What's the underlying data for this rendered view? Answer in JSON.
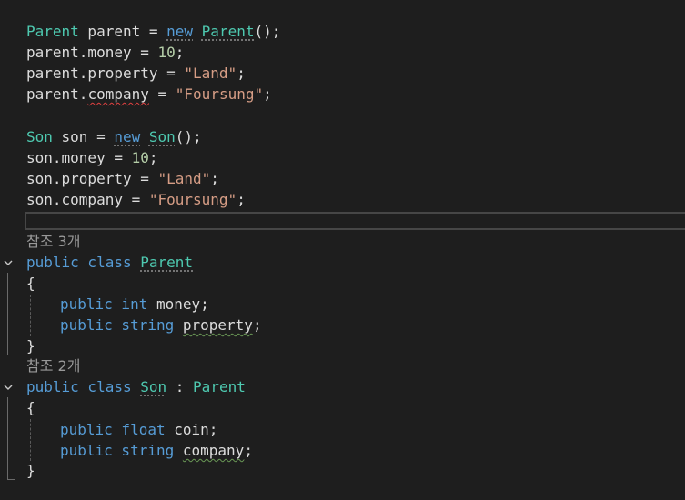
{
  "colors": {
    "background": "#1e1e1e",
    "keyword": "#569cd6",
    "type": "#4ec9b0",
    "string": "#d69d85",
    "number": "#b5cea8",
    "text": "#dcdcdc"
  },
  "code": {
    "l1": {
      "type": "Parent",
      "var": " parent = ",
      "kw": "new",
      "sp": " ",
      "ctor": "Parent",
      "end": "();"
    },
    "l2": {
      "text": "parent.money = ",
      "num": "10",
      "end": ";"
    },
    "l3": {
      "text": "parent.property = ",
      "str": "\"Land\"",
      "end": ";"
    },
    "l4": {
      "pre": "parent.",
      "field": "company",
      "mid": " = ",
      "str": "\"Foursung\"",
      "end": ";"
    },
    "l6": {
      "type": "Son",
      "var": " son = ",
      "kw": "new",
      "sp": " ",
      "ctor": "Son",
      "end": "();"
    },
    "l7": {
      "text": "son.money = ",
      "num": "10",
      "end": ";"
    },
    "l8": {
      "text": "son.property = ",
      "str": "\"Land\"",
      "end": ";"
    },
    "l9": {
      "text": "son.company = ",
      "str": "\"Foursung\"",
      "end": ";"
    },
    "lens1": "참조 3개",
    "c1": {
      "kw1": "public",
      "kw2": " class ",
      "name": "Parent"
    },
    "brace_open": "{",
    "brace_close": "}",
    "f1": {
      "kw": "public",
      "ty": " int",
      "rest": " money;"
    },
    "f2": {
      "kw": "public",
      "ty": " string",
      "sp": " ",
      "name": "property",
      "end": ";"
    },
    "lens2": "참조 2개",
    "c2": {
      "kw1": "public",
      "kw2": " class ",
      "name": "Son",
      "colon": " : ",
      "base": "Parent"
    },
    "f3": {
      "kw": "public",
      "ty": " float",
      "rest": " coin;"
    },
    "f4": {
      "kw": "public",
      "ty": " string",
      "sp": " ",
      "name": "company",
      "end": ";"
    }
  }
}
